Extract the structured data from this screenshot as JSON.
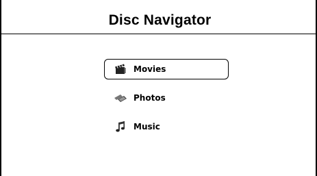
{
  "header": {
    "title": "Disc Navigator"
  },
  "menu": {
    "items": [
      {
        "label": "Movies",
        "icon": "clapperboard-icon",
        "selected": true
      },
      {
        "label": "Photos",
        "icon": "photos-icon",
        "selected": false
      },
      {
        "label": "Music",
        "icon": "music-note-icon",
        "selected": false
      }
    ]
  }
}
